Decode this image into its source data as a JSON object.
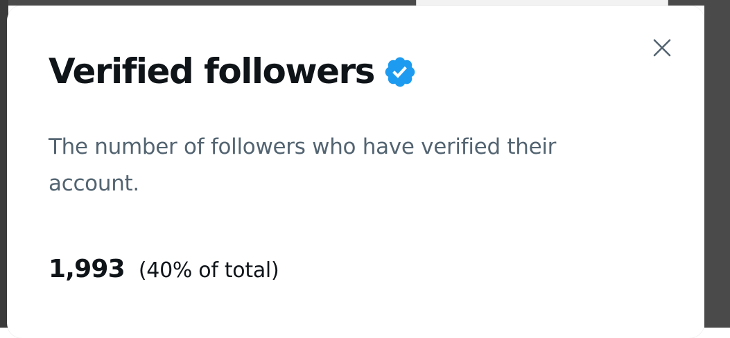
{
  "dialog": {
    "title": "Verified followers",
    "badge_icon": "verified-badge-icon",
    "close_icon": "close-icon",
    "description": "The number of followers who have verified their account.",
    "stat_value": "1,993",
    "stat_percent_text": "(40% of total)",
    "verified_fraction": 0.4
  },
  "colors": {
    "title": "#0f1419",
    "description": "#536471",
    "badge": "#1d9bf0",
    "close_icon": "#536471"
  }
}
